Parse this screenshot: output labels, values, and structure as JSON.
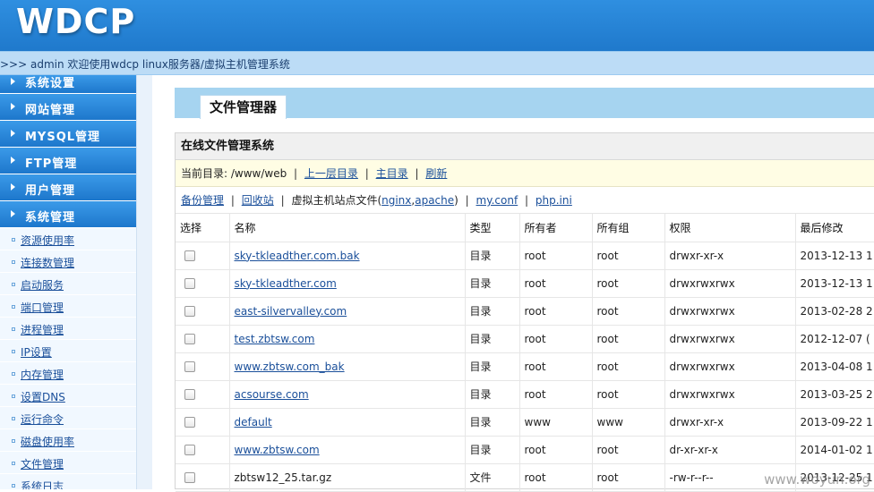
{
  "header": {
    "logo": "WDCP",
    "welcome": ">>> admin 欢迎使用wdcp linux服务器/虚拟主机管理系统"
  },
  "sidebar": {
    "menus": [
      {
        "label": "系统设置"
      },
      {
        "label": "网站管理"
      },
      {
        "label": "MYSQL管理"
      },
      {
        "label": "FTP管理"
      },
      {
        "label": "用户管理"
      },
      {
        "label": "系统管理"
      }
    ],
    "sub_items": [
      {
        "label": "资源使用率"
      },
      {
        "label": "连接数管理"
      },
      {
        "label": "启动服务"
      },
      {
        "label": "端口管理"
      },
      {
        "label": "进程管理"
      },
      {
        "label": "IP设置"
      },
      {
        "label": "内存管理"
      },
      {
        "label": "设置DNS"
      },
      {
        "label": "运行命令"
      },
      {
        "label": "磁盘使用率"
      },
      {
        "label": "文件管理"
      },
      {
        "label": "系统日志"
      }
    ]
  },
  "main": {
    "tab_label": "文件管理器",
    "panel_title": "在线文件管理系统",
    "current_dir": {
      "prefix": "当前目录: ",
      "path": "/www/web",
      "up_link": "上一层目录",
      "home_link": "主目录",
      "refresh_link": "刷新"
    },
    "links": {
      "backup": "备份管理",
      "recycle": "回收站",
      "vhost_prefix": "虚拟主机站点文件(",
      "nginx": "nginx",
      "comma": ",",
      "apache": "apache",
      "vhost_suffix": ")",
      "mysql_conf": "my.conf",
      "php_ini": "php.ini"
    },
    "table": {
      "headers": {
        "select": "选择",
        "name": "名称",
        "type": "类型",
        "owner": "所有者",
        "group": "所有组",
        "perm": "权限",
        "modified": "最后修改"
      },
      "rows": [
        {
          "name": "sky-tkleadther.com.bak",
          "type": "目录",
          "owner": "root",
          "group": "root",
          "perm": "drwxr-xr-x",
          "modified": "2013-12-13 1",
          "link": true
        },
        {
          "name": "sky-tkleadther.com",
          "type": "目录",
          "owner": "root",
          "group": "root",
          "perm": "drwxrwxrwx",
          "modified": "2013-12-13 1",
          "link": true
        },
        {
          "name": "east-silvervalley.com",
          "type": "目录",
          "owner": "root",
          "group": "root",
          "perm": "drwxrwxrwx",
          "modified": "2013-02-28 2",
          "link": true
        },
        {
          "name": "test.zbtsw.com",
          "type": "目录",
          "owner": "root",
          "group": "root",
          "perm": "drwxrwxrwx",
          "modified": "2012-12-07 (",
          "link": true
        },
        {
          "name": "www.zbtsw.com_bak",
          "type": "目录",
          "owner": "root",
          "group": "root",
          "perm": "drwxrwxrwx",
          "modified": "2013-04-08 1",
          "link": true
        },
        {
          "name": "acsourse.com",
          "type": "目录",
          "owner": "root",
          "group": "root",
          "perm": "drwxrwxrwx",
          "modified": "2013-03-25 2",
          "link": true
        },
        {
          "name": "default",
          "type": "目录",
          "owner": "www",
          "group": "www",
          "perm": "drwxr-xr-x",
          "modified": "2013-09-22 1",
          "link": true
        },
        {
          "name": "www.zbtsw.com",
          "type": "目录",
          "owner": "root",
          "group": "root",
          "perm": "dr-xr-xr-x",
          "modified": "2014-01-02 1",
          "link": true
        },
        {
          "name": "zbtsw12_25.tar.gz",
          "type": "文件",
          "owner": "root",
          "group": "root",
          "perm": "-rw-r--r--",
          "modified": "2013-12-25 1",
          "link": false
        }
      ]
    }
  },
  "watermark": "www.woyun.org"
}
